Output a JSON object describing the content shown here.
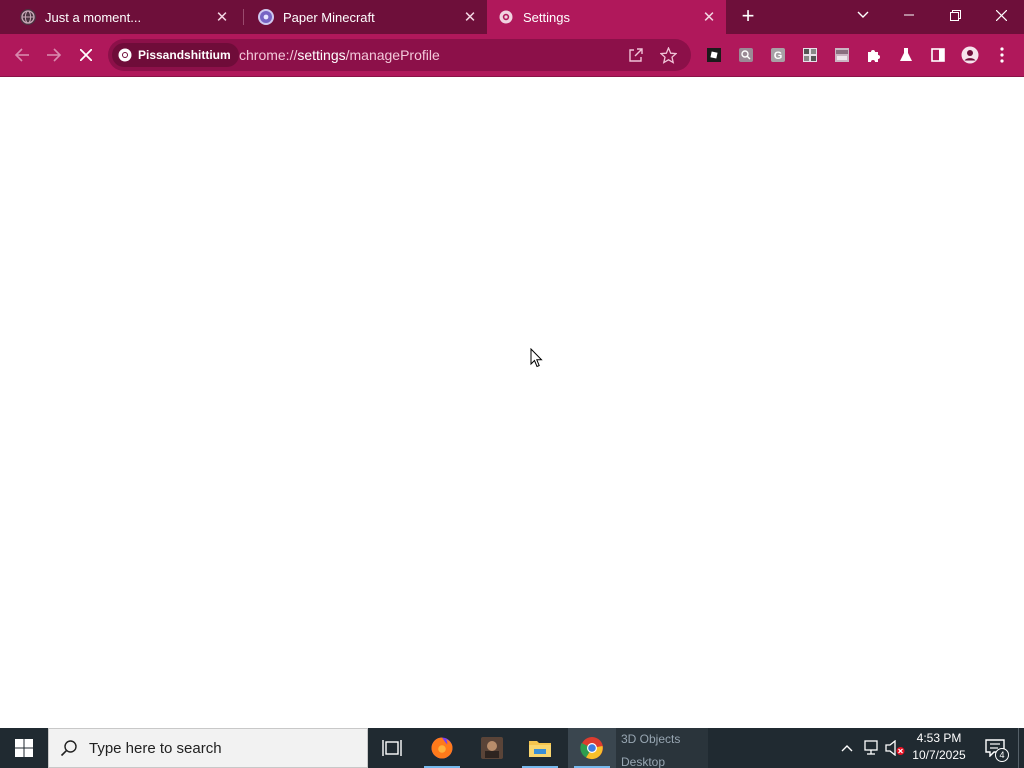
{
  "browser": {
    "tabs": [
      {
        "title": "Just a moment...",
        "icon": "globe-icon",
        "active": false
      },
      {
        "title": "Paper Minecraft",
        "icon": "gamepad-icon",
        "active": false
      },
      {
        "title": "Settings",
        "icon": "settings-gear-icon",
        "active": true
      }
    ],
    "close_glyph": "✕",
    "new_tab_glyph": "+",
    "profile_chip": "Pissandshittium",
    "url_scheme": "chrome://",
    "url_host": "settings",
    "url_path": "/manageProfile",
    "theme": {
      "tabstrip": "#6e0f3a",
      "toolbar": "#b0185b",
      "omnibox": "#8c1049"
    }
  },
  "extensions": [
    "roblox-icon",
    "search-extension-icon",
    "google-g-icon",
    "grid-extension-icon",
    "photo-extension-icon",
    "puzzle-icon",
    "flask-icon",
    "side-panel-icon",
    "profile-icon",
    "menu-dots-icon"
  ],
  "taskbar": {
    "search_placeholder": "Type here to search",
    "preview_lines": [
      "3D Objects",
      "Desktop"
    ],
    "time": "4:53 PM",
    "date": "10/7/2025",
    "notification_count": "4"
  }
}
